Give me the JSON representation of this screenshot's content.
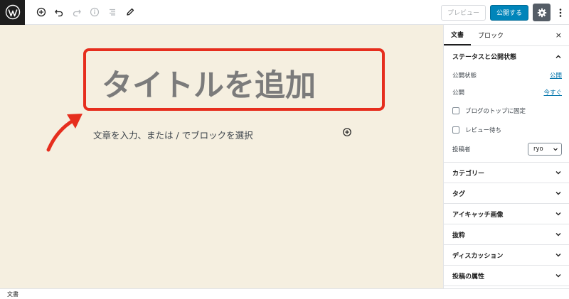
{
  "toolbar": {
    "logo_icon": "wordpress-icon",
    "icons": [
      "add-block-icon",
      "undo-icon",
      "redo-icon",
      "info-icon",
      "list-view-icon",
      "edit-tools-icon"
    ],
    "preview_label": "プレビュー",
    "publish_label": "公開する",
    "settings_icon": "gear-icon",
    "more_icon": "more-vertical-icon",
    "publish_color": "#0085ba"
  },
  "editor": {
    "title_placeholder": "タイトルを追加",
    "body_placeholder": "文章を入力、または / でブロックを選択",
    "highlight_color": "#e62e1e",
    "background_color": "#f5efe0"
  },
  "sidebar": {
    "tabs": [
      {
        "label": "文書",
        "active": true
      },
      {
        "label": "ブロック",
        "active": false
      }
    ],
    "close_label": "×",
    "status_panel": {
      "title": "ステータスと公開状態",
      "visibility_label": "公開状態",
      "visibility_value": "公開",
      "publish_label": "公開",
      "publish_value": "今すぐ",
      "sticky_label": "ブログのトップに固定",
      "pending_label": "レビュー待ち",
      "author_label": "投稿者",
      "author_value": "ryo"
    },
    "panels": [
      {
        "title": "カテゴリー"
      },
      {
        "title": "タグ"
      },
      {
        "title": "アイキャッチ画像"
      },
      {
        "title": "抜粋"
      },
      {
        "title": "ディスカッション"
      },
      {
        "title": "投稿の属性"
      }
    ]
  },
  "footer": {
    "breadcrumb": "文書"
  }
}
